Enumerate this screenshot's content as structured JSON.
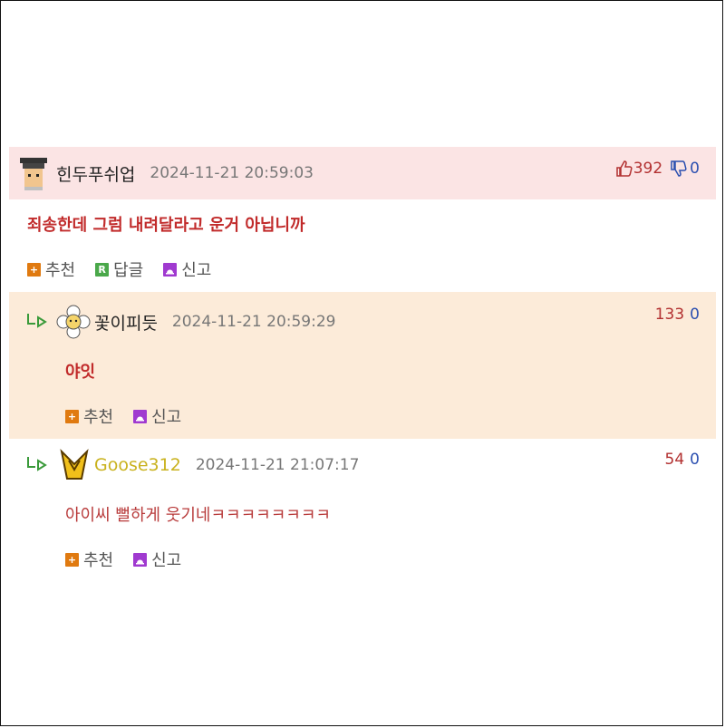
{
  "comments": [
    {
      "nickname": "힌두푸쉬업",
      "date": "2024-11-21 20:59:03",
      "up": "392",
      "down": "0",
      "text": "죄송한데 그럼 내려달라고 운거 아닙니까",
      "actions": [
        "추천",
        "답글",
        "신고"
      ],
      "avatar_icon": "graduate-avatar-icon"
    },
    {
      "nickname": "꽃이피듯",
      "date": "2024-11-21 20:59:29",
      "up": "133",
      "down": "0",
      "text": "야잇",
      "actions": [
        "추천",
        "신고"
      ],
      "avatar_icon": "flower-avatar-icon"
    },
    {
      "nickname": "Goose312",
      "date": "2024-11-21 21:07:17",
      "up": "54",
      "down": "0",
      "text": "아이씨 뻘하게 웃기네ㅋㅋㅋㅋㅋㅋㅋㅋ",
      "actions": [
        "추천",
        "신고"
      ],
      "avatar_icon": "yellow-badge-avatar-icon"
    }
  ],
  "colors": {
    "highlight_best": "#fbe4e4",
    "highlight_reply": "#fcebd9",
    "nickname_yellow": "#c9b21e"
  }
}
